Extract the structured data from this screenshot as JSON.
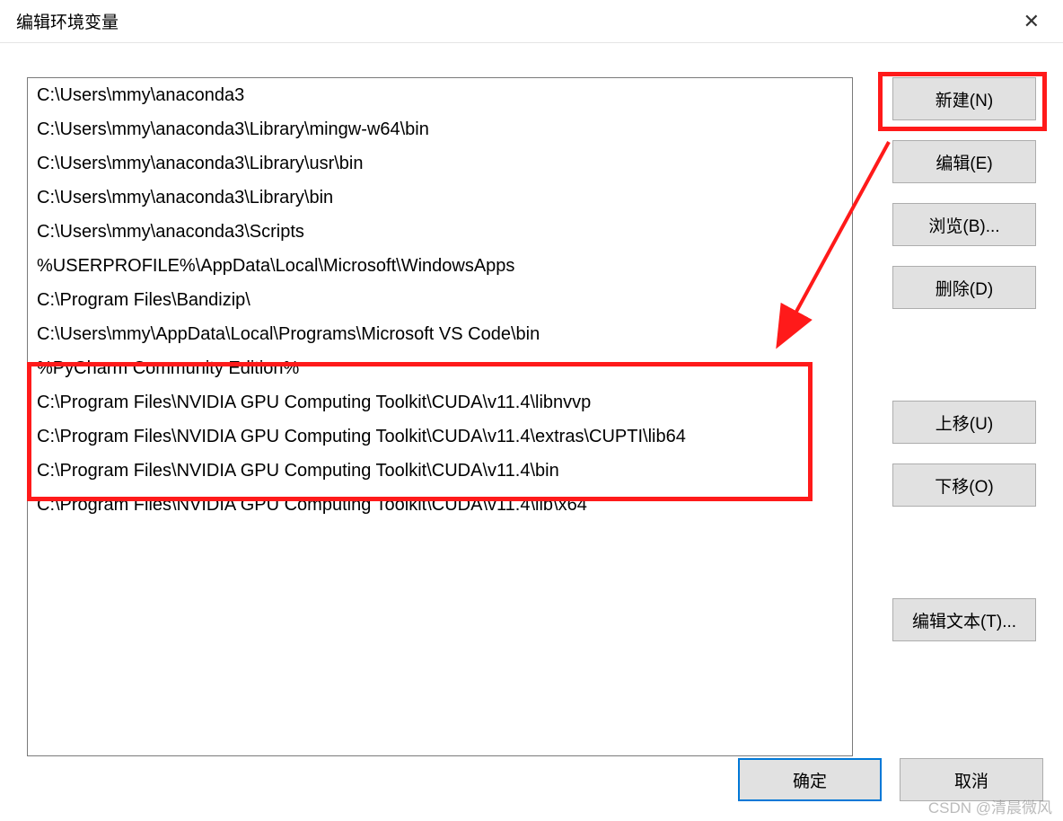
{
  "titlebar": {
    "title": "编辑环境变量"
  },
  "list": {
    "items": [
      "C:\\Users\\mmy\\anaconda3",
      "C:\\Users\\mmy\\anaconda3\\Library\\mingw-w64\\bin",
      "C:\\Users\\mmy\\anaconda3\\Library\\usr\\bin",
      "C:\\Users\\mmy\\anaconda3\\Library\\bin",
      "C:\\Users\\mmy\\anaconda3\\Scripts",
      "%USERPROFILE%\\AppData\\Local\\Microsoft\\WindowsApps",
      "C:\\Program Files\\Bandizip\\",
      "C:\\Users\\mmy\\AppData\\Local\\Programs\\Microsoft VS Code\\bin",
      "%PyCharm Community Edition%",
      "C:\\Program Files\\NVIDIA GPU Computing Toolkit\\CUDA\\v11.4\\libnvvp",
      "C:\\Program Files\\NVIDIA GPU Computing Toolkit\\CUDA\\v11.4\\extras\\CUPTI\\lib64",
      "C:\\Program Files\\NVIDIA GPU Computing Toolkit\\CUDA\\v11.4\\bin",
      "C:\\Program Files\\NVIDIA GPU Computing Toolkit\\CUDA\\v11.4\\lib\\x64"
    ]
  },
  "buttons": {
    "new": "新建(N)",
    "edit": "编辑(E)",
    "browse": "浏览(B)...",
    "delete": "删除(D)",
    "moveUp": "上移(U)",
    "moveDown": "下移(O)",
    "editText": "编辑文本(T)...",
    "ok": "确定",
    "cancel": "取消"
  },
  "watermark": "CSDN @清晨微风"
}
